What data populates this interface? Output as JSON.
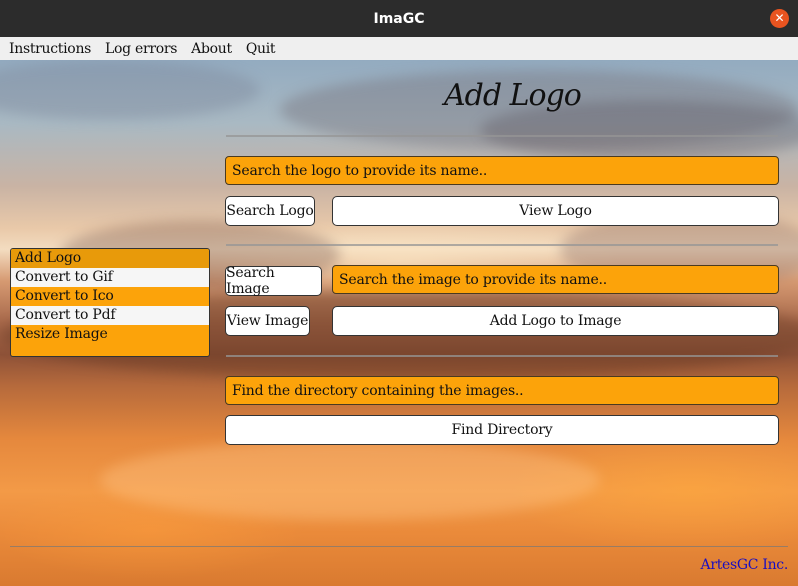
{
  "window": {
    "title": "ImaGC",
    "close_glyph": "✕"
  },
  "menu": {
    "items": [
      "Instructions",
      "Log errors",
      "About",
      "Quit"
    ]
  },
  "page": {
    "title": "Add Logo"
  },
  "logo_section": {
    "field_text": "Search the logo to provide its name..",
    "search_button": "Search Logo",
    "view_button": "View Logo"
  },
  "image_section": {
    "search_button": "Search Image",
    "field_text": "Search the image to provide its name..",
    "view_button": "View Image",
    "add_button": "Add Logo to Image"
  },
  "directory_section": {
    "field_text": "Find the directory containing the images..",
    "find_button": "Find Directory"
  },
  "sidebar": {
    "items": [
      "Add Logo",
      "Convert to Gif",
      "Convert to Ico",
      "Convert to Pdf",
      "Resize Image"
    ],
    "selected": "Add Logo"
  },
  "footer": {
    "text": "ArtesGC Inc."
  },
  "colors": {
    "accent": "#fca30a",
    "close_button": "#e95420",
    "footer_text": "#1a0ec0"
  }
}
